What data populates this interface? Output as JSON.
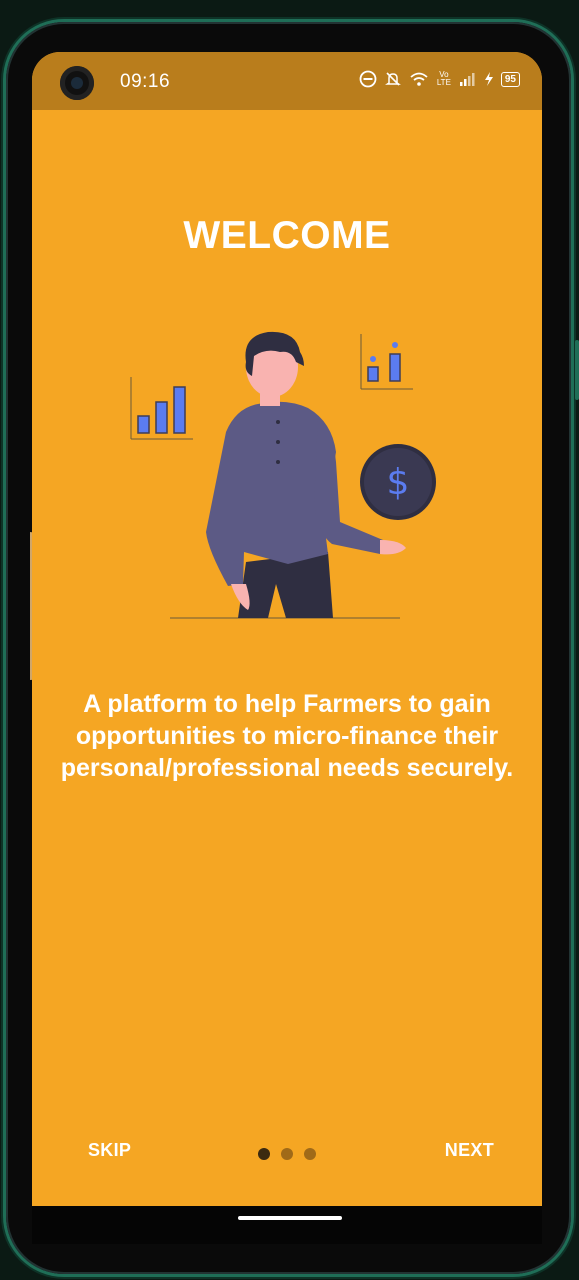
{
  "status_bar": {
    "time": "09:16",
    "battery": "95",
    "network_label": "Vo LTE"
  },
  "onboarding": {
    "title": "WELCOME",
    "description": "A platform to help Farmers to gain opportunities to micro-finance their personal/professional needs securely.",
    "illustration": {
      "subject": "person-with-coin",
      "coin_symbol": "$"
    },
    "pages": {
      "total": 3,
      "current": 1
    }
  },
  "navigation": {
    "skip_label": "SKIP",
    "next_label": "NEXT"
  },
  "colors": {
    "background": "#f5a623",
    "status_bar": "#b97d1c",
    "accent_bar": "#5b7cf0",
    "shirt": "#5c5a85"
  }
}
